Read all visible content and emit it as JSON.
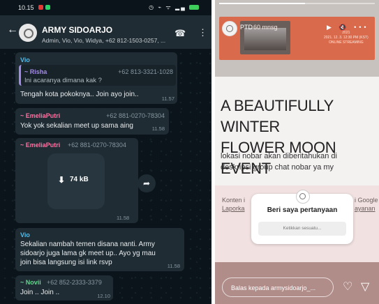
{
  "whatsapp": {
    "statusbar": {
      "time": "10.15",
      "icons": "◷ ⌁ ᯤ ▂▄"
    },
    "header": {
      "title": "ARMY SIDOARJO",
      "members": "Admin, Vio, Vio, Widya, +62 812-1503-0257, ...",
      "back_icon": "←",
      "call_icon": "☎",
      "menu_icon": "⋮"
    },
    "messages": [
      {
        "sender": "Vio",
        "quote_sender": "~ Risha",
        "quote_phone": "+62 813-3321-1028",
        "quote_text": "Ini acaranya dimana kak ?",
        "text": "Tengah kota pokoknya.. Join ayo join..",
        "time": "11.57"
      },
      {
        "sender": "~ EmeliaPutri",
        "phone": "+62 881-0270-78304",
        "text": "Yok yok sekalian meet up sama aing",
        "time": "11.58"
      },
      {
        "sender": "~ EmeliaPutri",
        "phone": "+62 881-0270-78304",
        "file_size": "74 kB",
        "time": "11.58"
      },
      {
        "sender": "Vio",
        "text_lines": [
          "Sekalian nambah temen disana nanti. Army",
          "sidoarjo juga lama gk meet up.. Ayo yg mau",
          "join bisa langsung isi link rsvp"
        ],
        "time": "11.58"
      },
      {
        "sender": "~ Novii",
        "phone": "+62 852-2333-3379",
        "text": "Join .. Join ..",
        "time": "12.10"
      }
    ]
  },
  "story": {
    "username": "PTD",
    "time_ago": "60 mnsg",
    "banner_text": [
      "2021",
      "2021. 12. 3. 12:30 PM (KST)",
      "ONLINE STREAMING"
    ],
    "controls": "▶ 🔇 •••",
    "progress": 0.55,
    "title_lines": [
      "A BEAUTIFULLY WINTER",
      "FLOWER MOON EVENT"
    ],
    "desc_lines": [
      "lokasi nobar akan diberitahukan di",
      "deskripsi group chat nobar ya my"
    ],
    "under_left": "Konten i",
    "under_left_link": "Laporka",
    "under_right": "i Google",
    "under_right_link": "ayanan",
    "question_title": "Beri saya pertanyaan",
    "question_placeholder": "Ketikkan sesuatu...",
    "reply_placeholder": "Balas kepada armysidoarjo_...",
    "heart_icon": "♡",
    "send_icon": "▽"
  }
}
